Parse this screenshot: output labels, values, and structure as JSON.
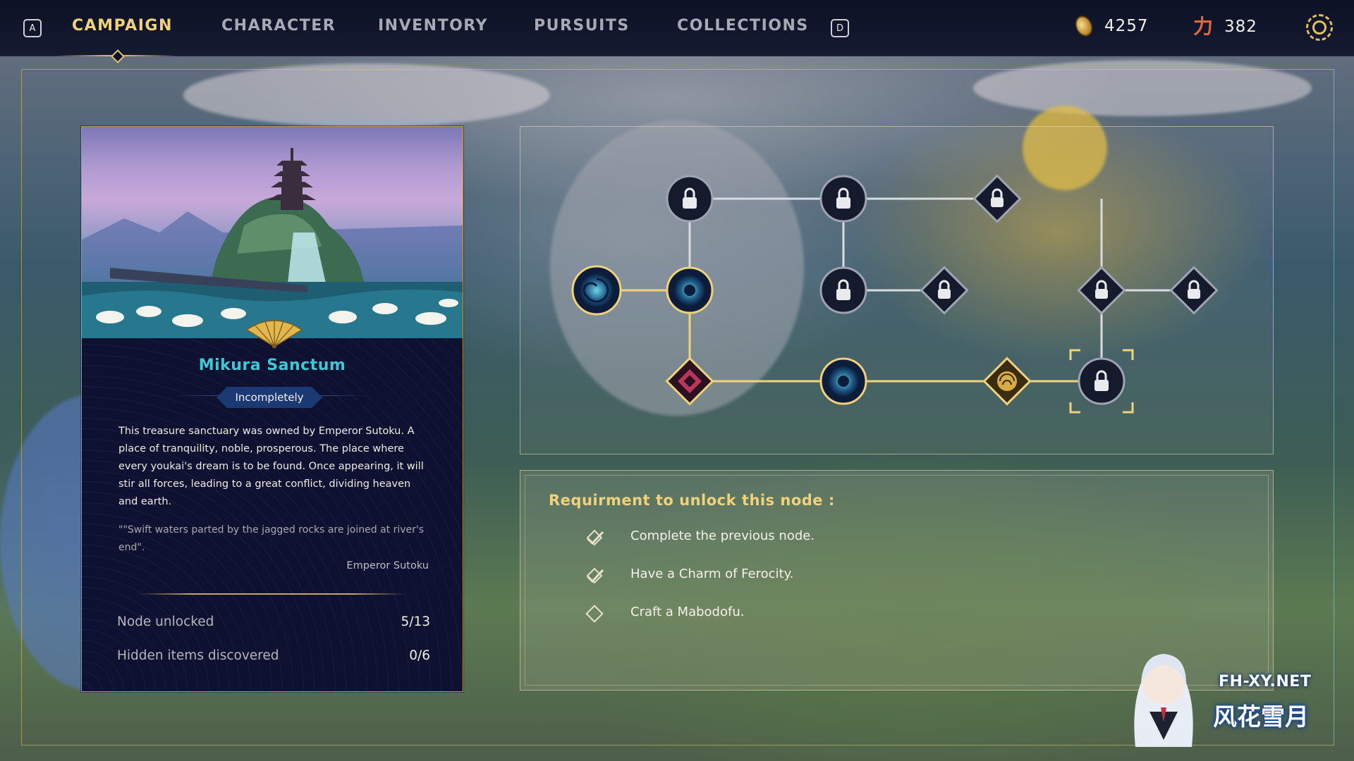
{
  "topbar": {
    "key_left": "A",
    "key_right": "D",
    "tabs": [
      {
        "label": "CAMPAIGN",
        "active": true
      },
      {
        "label": "CHARACTER",
        "active": false
      },
      {
        "label": "INVENTORY",
        "active": false
      },
      {
        "label": "PURSUITS",
        "active": false
      },
      {
        "label": "COLLECTIONS",
        "active": false
      }
    ],
    "currency_coins": "4257",
    "currency_power": "382",
    "power_glyph": "力"
  },
  "card": {
    "title": "Mikura Sanctum",
    "status": "Incompletely",
    "description": "This treasure sanctuary was owned by Emperor Sutoku. A place of tranquility, noble, prosperous. The place where every youkai's dream is to be found. Once appearing, it will stir all forces, leading to a great conflict, dividing heaven and earth.",
    "quote": "\"\"Swift waters parted by the jagged rocks are joined at river's end\".",
    "quote_author": "Emperor Sutoku",
    "stats": [
      {
        "label": "Node unlocked",
        "value": "5/13"
      },
      {
        "label": "Hidden items discovered",
        "value": "0/6"
      }
    ]
  },
  "requirements": {
    "title": "Requirment to unlock this node :",
    "items": [
      {
        "text": "Complete the previous node.",
        "done": true
      },
      {
        "text": "Have a Charm of Ferocity.",
        "done": true
      },
      {
        "text": "Craft a Mabodofu.",
        "done": false
      }
    ]
  },
  "tree": {
    "nodes": [
      {
        "id": "n1",
        "shape": "circle",
        "state": "locked"
      },
      {
        "id": "n2",
        "shape": "circle",
        "state": "locked"
      },
      {
        "id": "n3",
        "shape": "diamond",
        "state": "locked"
      },
      {
        "id": "n4",
        "shape": "circle",
        "state": "unlocked-active"
      },
      {
        "id": "n5",
        "shape": "circle",
        "state": "unlocked"
      },
      {
        "id": "n6",
        "shape": "circle",
        "state": "locked"
      },
      {
        "id": "n7",
        "shape": "diamond",
        "state": "locked"
      },
      {
        "id": "n8",
        "shape": "diamond",
        "state": "locked"
      },
      {
        "id": "n9",
        "shape": "diamond",
        "state": "locked"
      },
      {
        "id": "n10",
        "shape": "diamond",
        "state": "unlocked"
      },
      {
        "id": "n11",
        "shape": "circle",
        "state": "unlocked"
      },
      {
        "id": "n12",
        "shape": "diamond",
        "state": "unlocked"
      },
      {
        "id": "n13",
        "shape": "circle",
        "state": "locked-selected"
      }
    ]
  },
  "watermark": {
    "site": "FH-XY.NET",
    "cn": "风花雪月"
  },
  "colors": {
    "accent_gold": "#f1d27a",
    "title_cyan": "#3fc7d6",
    "panel_navy": "#0e1230"
  }
}
